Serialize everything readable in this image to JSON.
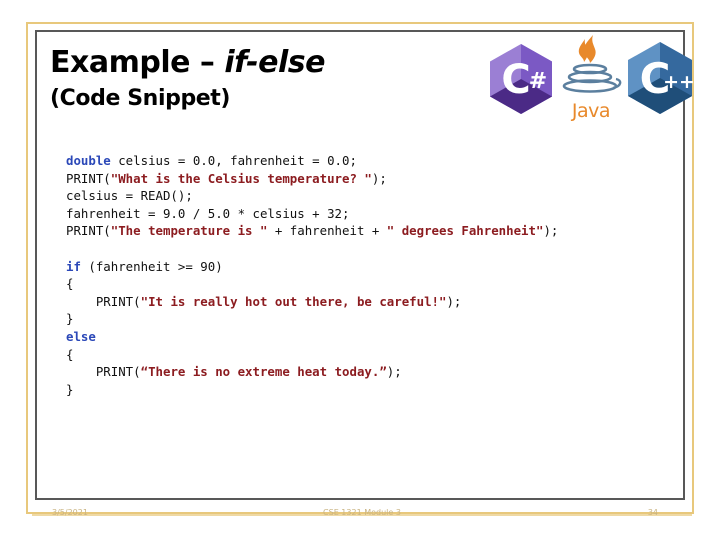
{
  "slide": {
    "title_prefix": "Example – ",
    "title_keyword": "if-else",
    "subtitle": "(Code Snippet)",
    "frame_color": "#e8c87c",
    "inner_frame_color": "#585858"
  },
  "logos": {
    "csharp": {
      "name": "csharp-logo",
      "letter": "C",
      "symbol": "#",
      "color_light": "#9b7fd4",
      "color_dark": "#4b2a86"
    },
    "java": {
      "name": "java-logo",
      "word": "Java",
      "color_flame": "#e8892b",
      "color_cup": "#5b7f9e",
      "color_word": "#e8892b"
    },
    "cpp": {
      "name": "cpp-logo",
      "letter": "C",
      "symbol": "++",
      "color_light": "#5f92c4",
      "color_dark": "#1f4e79"
    }
  },
  "code": {
    "keyword_color": "#2b48b8",
    "string_color": "#8c1c20",
    "text_color": "#111111",
    "lines": [
      {
        "tokens": [
          {
            "t": "kw",
            "v": "double"
          },
          {
            "t": "txt",
            "v": " celsius = 0.0, fahrenheit = 0.0;"
          }
        ]
      },
      {
        "tokens": [
          {
            "t": "txt",
            "v": "PRINT("
          },
          {
            "t": "str",
            "v": "\"What is the Celsius temperature? \""
          },
          {
            "t": "txt",
            "v": ");"
          }
        ]
      },
      {
        "tokens": [
          {
            "t": "txt",
            "v": "celsius = READ();"
          }
        ]
      },
      {
        "tokens": [
          {
            "t": "txt",
            "v": "fahrenheit = 9.0 / 5.0 * celsius + 32;"
          }
        ]
      },
      {
        "tokens": [
          {
            "t": "txt",
            "v": "PRINT("
          },
          {
            "t": "str",
            "v": "\"The temperature is \""
          },
          {
            "t": "txt",
            "v": " + fahrenheit + "
          },
          {
            "t": "str",
            "v": "\" degrees Fahrenheit\""
          },
          {
            "t": "txt",
            "v": ");"
          }
        ]
      },
      {
        "tokens": []
      },
      {
        "tokens": [
          {
            "t": "kw",
            "v": "if"
          },
          {
            "t": "txt",
            "v": " (fahrenheit >= 90)"
          }
        ]
      },
      {
        "tokens": [
          {
            "t": "txt",
            "v": "{"
          }
        ]
      },
      {
        "tokens": [
          {
            "t": "txt",
            "v": "    PRINT("
          },
          {
            "t": "str",
            "v": "\"It is really hot out there, be careful!\""
          },
          {
            "t": "txt",
            "v": ");"
          }
        ]
      },
      {
        "tokens": [
          {
            "t": "txt",
            "v": "}"
          }
        ]
      },
      {
        "tokens": [
          {
            "t": "kw",
            "v": "else"
          }
        ]
      },
      {
        "tokens": [
          {
            "t": "txt",
            "v": "{"
          }
        ]
      },
      {
        "tokens": [
          {
            "t": "txt",
            "v": "    PRINT("
          },
          {
            "t": "str",
            "v": "“There is no extreme heat today.”"
          },
          {
            "t": "txt",
            "v": ");"
          }
        ]
      },
      {
        "tokens": [
          {
            "t": "txt",
            "v": "}"
          }
        ]
      }
    ]
  },
  "footer": {
    "date": "3/5/2021",
    "center": "CSE 1321 Module 3",
    "page": "34",
    "color": "#c9b381"
  }
}
